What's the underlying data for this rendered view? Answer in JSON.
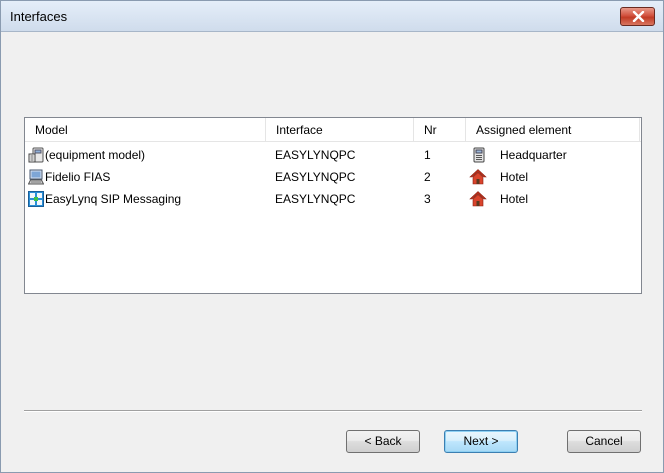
{
  "window": {
    "title": "Interfaces",
    "close_icon": "close-icon"
  },
  "list": {
    "columns": [
      "Model",
      "Interface",
      "Nr",
      "Assigned element"
    ],
    "rows": [
      {
        "model": "(equipment model)",
        "model_icon": "equipment-icon",
        "interface": "EASYLYNQPC",
        "nr": "1",
        "assigned": "Headquarter",
        "assigned_icon": "headquarter-icon"
      },
      {
        "model": "Fidelio FIAS",
        "model_icon": "computer-icon",
        "interface": "EASYLYNQPC",
        "nr": "2",
        "assigned": "Hotel",
        "assigned_icon": "hotel-house-icon"
      },
      {
        "model": "EasyLynq SIP Messaging",
        "model_icon": "network-icon",
        "interface": "EASYLYNQPC",
        "nr": "3",
        "assigned": "Hotel",
        "assigned_icon": "hotel-house-icon"
      }
    ]
  },
  "buttons": {
    "back": "< Back",
    "next": "Next >",
    "cancel": "Cancel"
  },
  "colors": {
    "hotel_roof": "#c0321e",
    "close_button": "#c9442e",
    "default_button_border": "#3c7fb1"
  }
}
